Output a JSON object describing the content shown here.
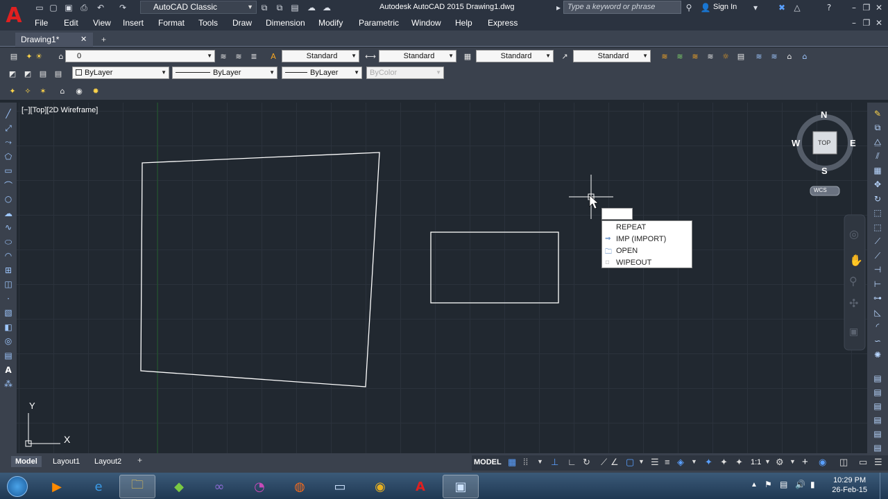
{
  "app": {
    "window_title": "Autodesk AutoCAD 2015    Drawing1.dwg",
    "workspace": "AutoCAD Classic",
    "search_placeholder": "Type a keyword or phrase",
    "sign_in": "Sign In"
  },
  "menu": [
    "File",
    "Edit",
    "View",
    "Insert",
    "Format",
    "Tools",
    "Draw",
    "Dimension",
    "Modify",
    "Parametric",
    "Window",
    "Help",
    "Express"
  ],
  "document_tab": "Drawing1*",
  "layer_dropdown": "0",
  "styles": {
    "text_style": "Standard",
    "dim_style": "Standard",
    "table_style": "Standard",
    "mleader_style": "Standard"
  },
  "properties": {
    "color": "ByLayer",
    "linetype": "ByLayer",
    "lineweight": "ByLayer",
    "plotstyle": "ByColor"
  },
  "viewport_label": "[−][Top][2D Wireframe]",
  "viewcube": {
    "n": "N",
    "s": "S",
    "e": "E",
    "w": "W",
    "face": "TOP",
    "wcs": "WCS"
  },
  "context_menu": [
    "REPEAT",
    "IMP (IMPORT)",
    "OPEN",
    "WIPEOUT"
  ],
  "ucs": {
    "x": "X",
    "y": "Y"
  },
  "layout_tabs": [
    "Model",
    "Layout1",
    "Layout2"
  ],
  "status": {
    "model": "MODEL",
    "scale": "1:1"
  },
  "clock": {
    "time": "10:29 PM",
    "date": "26-Feb-15"
  }
}
